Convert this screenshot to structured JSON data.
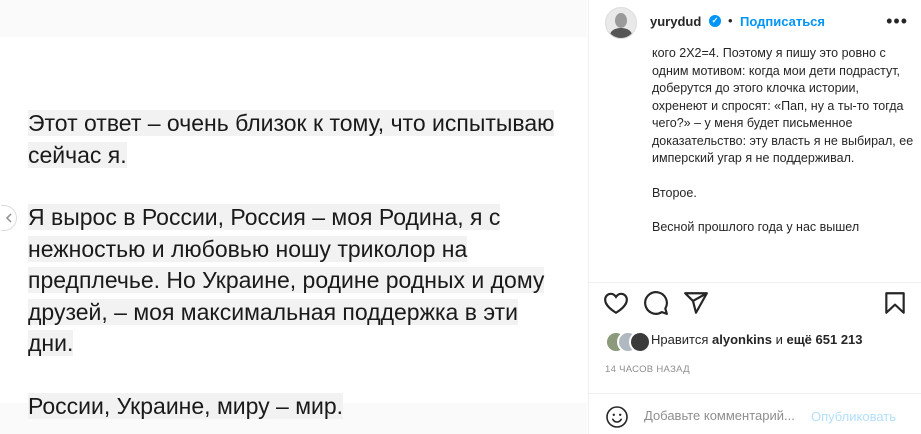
{
  "post_image": {
    "paragraphs": [
      "Этот ответ – очень близок к тому, что испытываю сейчас я.",
      "Я вырос в России, Россия – моя Родина, я с нежностью и любовью ношу триколор на предплечье. Но Украине, родине родных и дому друзей, – моя максимальная поддержка в эти дни.",
      "России, Украине, миру – мир."
    ],
    "prev_icon": "chevron-left-icon"
  },
  "header": {
    "username": "yurydud",
    "verified_icon": "verified-badge-icon",
    "separator": "•",
    "follow_label": "Подписаться",
    "more_icon": "more-options-icon"
  },
  "caption": {
    "paragraphs": [
      "кого 2Х2=4. Поэтому я пишу это ровно с одним мотивом: когда мои дети подрастут, доберутся до этого клочка истории, охренеют и спросят: «Пап, ну а ты-то тогда чего?» – у меня будет письменное доказательство: эту власть я не выбирал, ее имперский угар я не поддерживал.",
      "Второе.",
      "Весной прошлого года у нас вышел"
    ]
  },
  "actions": {
    "like_icon": "heart-icon",
    "comment_icon": "comment-icon",
    "share_icon": "share-icon",
    "save_icon": "bookmark-icon"
  },
  "likes": {
    "prefix": "Нравится",
    "user": "alyonkins",
    "and": "и",
    "count": "ещё 651 213"
  },
  "time": "14 ЧАСОВ НАЗАД",
  "comment": {
    "placeholder": "Добавьте комментарий...",
    "publish_label": "Опубликовать",
    "emoji_icon": "emoji-icon"
  }
}
